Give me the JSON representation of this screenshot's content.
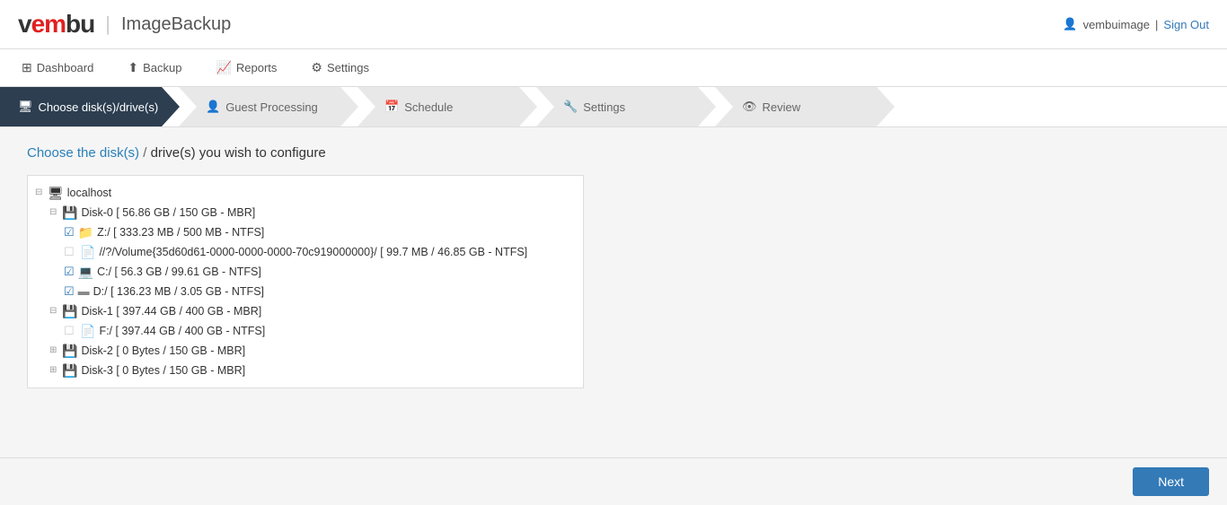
{
  "header": {
    "logo": "vembu",
    "logo_highlight": "em",
    "product": "ImageBackup",
    "user": "vembuimage",
    "signout_label": "Sign Out"
  },
  "navbar": {
    "items": [
      {
        "id": "dashboard",
        "icon": "⊞",
        "label": "Dashboard"
      },
      {
        "id": "backup",
        "icon": "⬆",
        "label": "Backup"
      },
      {
        "id": "reports",
        "icon": "📈",
        "label": "Reports"
      },
      {
        "id": "settings",
        "icon": "⚙",
        "label": "Settings"
      }
    ]
  },
  "wizard": {
    "steps": [
      {
        "id": "choose-disks",
        "icon": "🖥",
        "label": "Choose disk(s)/drive(s)",
        "active": true
      },
      {
        "id": "guest-processing",
        "icon": "👤",
        "label": "Guest Processing",
        "active": false
      },
      {
        "id": "schedule",
        "icon": "📅",
        "label": "Schedule",
        "active": false
      },
      {
        "id": "settings",
        "icon": "🔧",
        "label": "Settings",
        "active": false
      },
      {
        "id": "review",
        "icon": "👁",
        "label": "Review",
        "active": false
      }
    ]
  },
  "page": {
    "title_part1": "Choose the disk(s)",
    "title_sep": " / ",
    "title_part2": "drive(s) you wish to configure"
  },
  "tree": {
    "root": {
      "label": "localhost",
      "children": [
        {
          "label": "Disk-0 [ 56.86 GB / 150 GB - MBR]",
          "type": "disk",
          "children": [
            {
              "label": "Z:/ [ 333.23 MB / 500 MB - NTFS]",
              "type": "drive",
              "checked": true
            },
            {
              "label": "//?/Volume{35d60d61-0000-0000-0000-70c919000000}/ [ 99.7 MB / 46.85 GB - NTFS]",
              "type": "volume",
              "checked": false
            },
            {
              "label": "C:/ [ 56.3 GB / 99.61 GB - NTFS]",
              "type": "drive",
              "checked": true
            },
            {
              "label": "D:/ [ 136.23 MB / 3.05 GB - NTFS]",
              "type": "drive",
              "checked": true
            }
          ]
        },
        {
          "label": "Disk-1 [ 397.44 GB / 400 GB - MBR]",
          "type": "disk",
          "children": [
            {
              "label": "F:/ [ 397.44 GB / 400 GB - NTFS]",
              "type": "drive",
              "checked": false
            }
          ]
        },
        {
          "label": "Disk-2 [ 0 Bytes / 150 GB - MBR]",
          "type": "disk",
          "children": []
        },
        {
          "label": "Disk-3 [ 0 Bytes / 150 GB - MBR]",
          "type": "disk",
          "children": []
        }
      ]
    }
  },
  "footer": {
    "next_label": "Next"
  }
}
